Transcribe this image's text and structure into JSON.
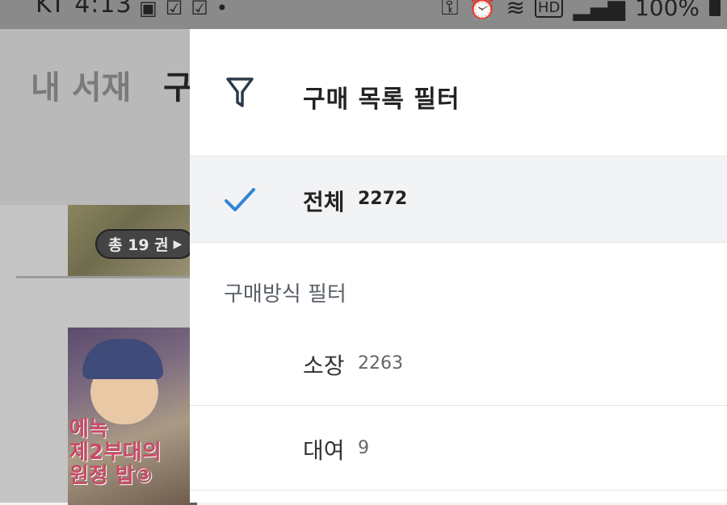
{
  "status_bar": {
    "carrier_time": "KT 4:13",
    "left_icons": [
      "gallery-icon",
      "check-icon",
      "check-icon",
      "dot-icon"
    ],
    "right_icons": [
      "key-icon",
      "alarm-icon",
      "wifi-icon",
      "hd-icon",
      "signal-icon"
    ],
    "battery": "100%"
  },
  "background": {
    "tab_library": "내 서재",
    "tab_purchase": "구",
    "volume_badge": "총 19 권",
    "book_title_line1": "에녹",
    "book_title_line2": "제2부대의",
    "book_title_line3": "원정 밥③"
  },
  "drawer": {
    "title": "구매 목록 필터",
    "all": {
      "label": "전체",
      "count": "2272",
      "selected": true
    },
    "section_title": "구매방식 필터",
    "items": [
      {
        "label": "소장",
        "count": "2263"
      },
      {
        "label": "대여",
        "count": "9"
      }
    ]
  },
  "colors": {
    "accent": "#2f86d6",
    "text": "#232323",
    "selected_bg": "#f2f3f5"
  }
}
